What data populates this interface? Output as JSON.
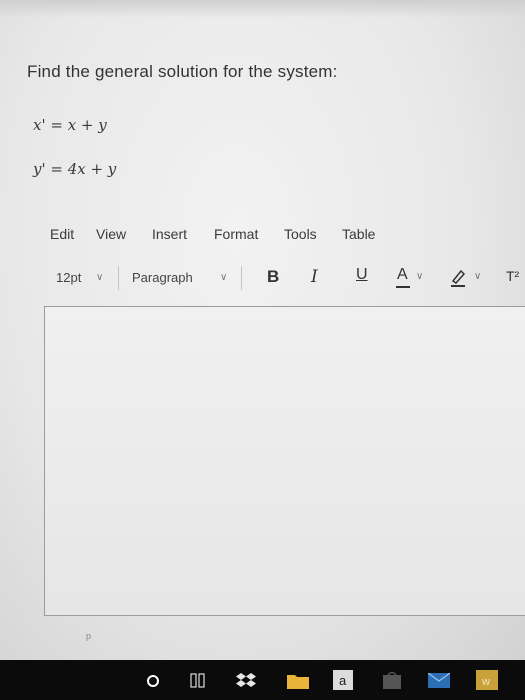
{
  "question": {
    "prompt": "Find the general solution for the system:",
    "equation1": "x' = x + y",
    "equation2": "y' = 4x + y"
  },
  "menu": {
    "items": [
      "Edit",
      "View",
      "Insert",
      "Format",
      "Tools",
      "Table"
    ]
  },
  "toolbar": {
    "font_size": "12pt",
    "block_format": "Paragraph",
    "bold": "B",
    "italic": "I",
    "underline": "U",
    "text_color": "A",
    "more": "T²"
  },
  "editor": {
    "status_path": "p"
  },
  "taskbar": {
    "icons": [
      "cortana-circle-icon",
      "task-view-icon",
      "dropbox-icon",
      "file-explorer-icon",
      "amazon-icon",
      "store-icon",
      "mail-icon",
      "word-icon"
    ],
    "colors": {
      "folder": "#e8b53a",
      "mail": "#2d6fb5",
      "word": "#c9a13b",
      "background": "#0b0b0b"
    }
  }
}
